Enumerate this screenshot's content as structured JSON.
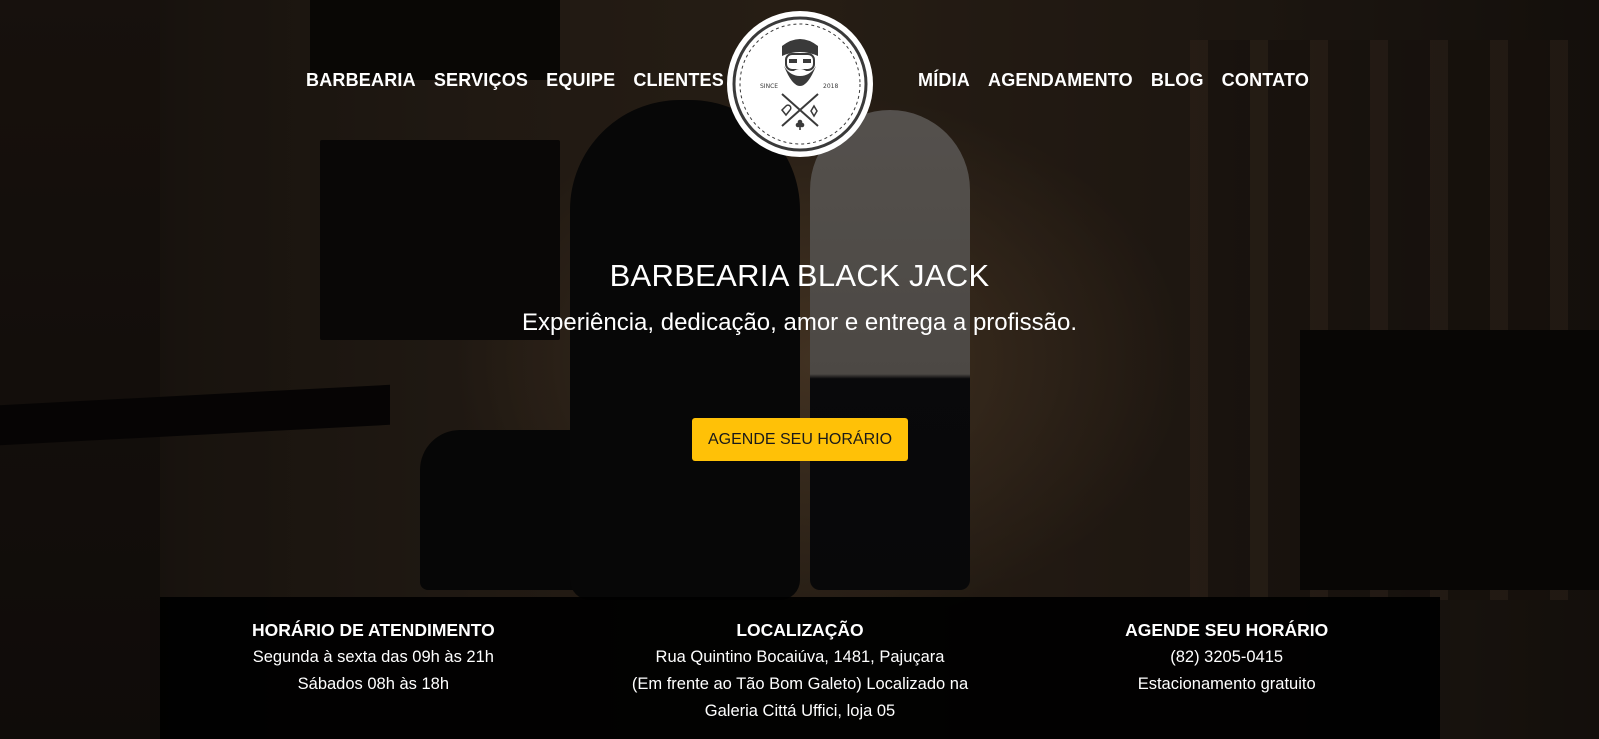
{
  "nav": {
    "left": [
      "BARBEARIA",
      "SERVIÇOS",
      "EQUIPE",
      "CLIENTES"
    ],
    "right": [
      "MÍDIA",
      "AGENDAMENTO",
      "BLOG",
      "CONTATO"
    ]
  },
  "logo": {
    "since_label": "SINCE",
    "year_label": "2018",
    "icon": "bearded-man-barber-logo"
  },
  "hero": {
    "title": "BARBEARIA BLACK JACK",
    "subtitle": "Experiência, dedicação, amor e entrega a profissão.",
    "cta_label": "AGENDE SEU HORÁRIO"
  },
  "info": {
    "hours": {
      "title": "HORÁRIO DE ATENDIMENTO",
      "lines": [
        "Segunda à sexta das 09h às 21h",
        "Sábados 08h às 18h"
      ]
    },
    "location": {
      "title": "LOCALIZAÇÃO",
      "lines": [
        "Rua Quintino Bocaiúva, 1481, Pajuçara",
        "(Em frente ao Tão Bom Galeto) Localizado na",
        "Galeria Cittá Uffici, loja 05"
      ]
    },
    "booking": {
      "title": "AGENDE SEU HORÁRIO",
      "lines": [
        "(82) 3205-0415",
        "Estacionamento gratuito"
      ]
    }
  },
  "colors": {
    "accent": "#ffc107",
    "info_bar": "#000000",
    "text": "#ffffff"
  }
}
